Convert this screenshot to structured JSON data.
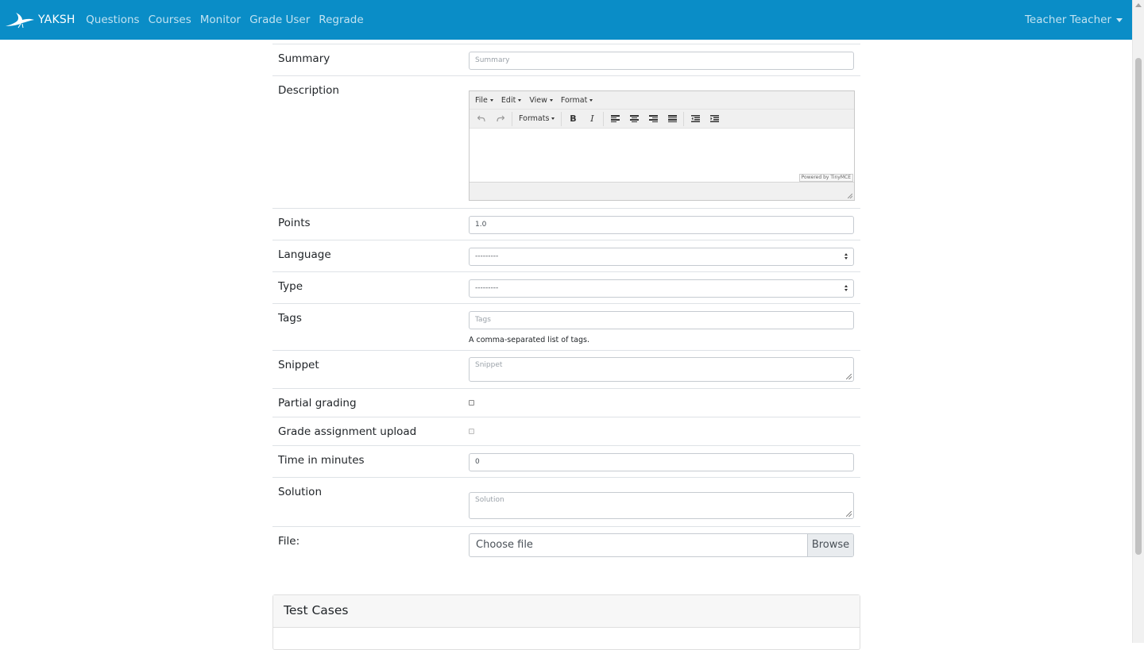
{
  "navbar": {
    "brand": "YAKSH",
    "links": [
      "Questions",
      "Courses",
      "Monitor",
      "Grade User",
      "Regrade"
    ],
    "user": "Teacher Teacher"
  },
  "form": {
    "summary": {
      "label": "Summary",
      "placeholder": "Summary"
    },
    "description": {
      "label": "Description",
      "menus": [
        "File",
        "Edit",
        "View",
        "Format"
      ],
      "formats_label": "Formats",
      "bold_glyph": "B",
      "italic_glyph": "I",
      "powered_by": "Powered by TinyMCE"
    },
    "points": {
      "label": "Points",
      "value": "1.0"
    },
    "language": {
      "label": "Language",
      "selected": "---------"
    },
    "type": {
      "label": "Type",
      "selected": "---------"
    },
    "tags": {
      "label": "Tags",
      "placeholder": "Tags",
      "help": "A comma-separated list of tags."
    },
    "snippet": {
      "label": "Snippet",
      "placeholder": "Snippet"
    },
    "partial_grading": {
      "label": "Partial grading"
    },
    "grade_assignment_upload": {
      "label": "Grade assignment upload"
    },
    "time_in_minutes": {
      "label": "Time in minutes",
      "value": "0"
    },
    "solution": {
      "label": "Solution",
      "placeholder": "Solution"
    },
    "file": {
      "label": "File:",
      "choose": "Choose file",
      "browse": "Browse"
    }
  },
  "test_cases": {
    "title": "Test Cases"
  },
  "colors": {
    "navbar": "#0a8dc7",
    "border": "#dee2e6"
  },
  "icons": {
    "brand": "crane-bird-icon",
    "undo": "undo-icon",
    "redo": "redo-icon",
    "align": [
      "align-left-icon",
      "align-center-icon",
      "align-right-icon",
      "align-justify-icon"
    ],
    "indent": [
      "outdent-icon",
      "indent-icon"
    ]
  }
}
